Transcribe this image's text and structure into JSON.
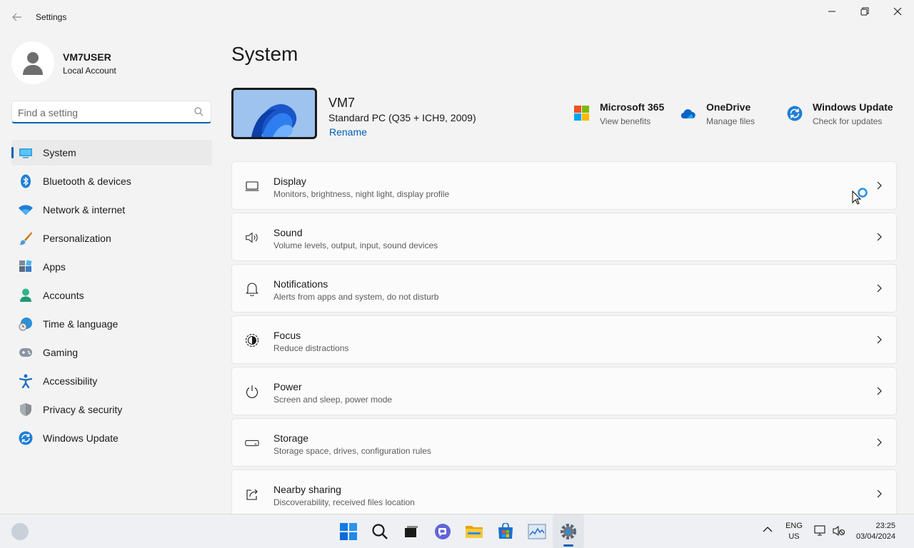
{
  "window": {
    "title": "Settings"
  },
  "user": {
    "name": "VM7USER",
    "account_type": "Local Account"
  },
  "search": {
    "placeholder": "Find a setting"
  },
  "nav": {
    "items": [
      {
        "label": "System",
        "icon": "monitor-icon",
        "active": true
      },
      {
        "label": "Bluetooth & devices",
        "icon": "bluetooth-icon"
      },
      {
        "label": "Network & internet",
        "icon": "wifi-icon"
      },
      {
        "label": "Personalization",
        "icon": "brush-icon"
      },
      {
        "label": "Apps",
        "icon": "apps-icon"
      },
      {
        "label": "Accounts",
        "icon": "person-icon"
      },
      {
        "label": "Time & language",
        "icon": "globe-clock-icon"
      },
      {
        "label": "Gaming",
        "icon": "gamepad-icon"
      },
      {
        "label": "Accessibility",
        "icon": "accessibility-icon"
      },
      {
        "label": "Privacy & security",
        "icon": "shield-icon"
      },
      {
        "label": "Windows Update",
        "icon": "update-icon"
      }
    ]
  },
  "page": {
    "title": "System"
  },
  "device": {
    "name": "VM7",
    "spec": "Standard PC (Q35 + ICH9, 2009)",
    "rename_label": "Rename"
  },
  "quick_links": [
    {
      "title": "Microsoft 365",
      "subtitle": "View benefits",
      "icon": "microsoft-logo-icon"
    },
    {
      "title": "OneDrive",
      "subtitle": "Manage files",
      "icon": "cloud-icon"
    },
    {
      "title": "Windows Update",
      "subtitle": "Check for updates",
      "icon": "update-icon"
    }
  ],
  "settings_cards": [
    {
      "title": "Display",
      "subtitle": "Monitors, brightness, night light, display profile",
      "icon": "laptop-icon"
    },
    {
      "title": "Sound",
      "subtitle": "Volume levels, output, input, sound devices",
      "icon": "speaker-icon"
    },
    {
      "title": "Notifications",
      "subtitle": "Alerts from apps and system, do not disturb",
      "icon": "bell-icon"
    },
    {
      "title": "Focus",
      "subtitle": "Reduce distractions",
      "icon": "focus-icon"
    },
    {
      "title": "Power",
      "subtitle": "Screen and sleep, power mode",
      "icon": "power-icon"
    },
    {
      "title": "Storage",
      "subtitle": "Storage space, drives, configuration rules",
      "icon": "storage-icon"
    },
    {
      "title": "Nearby sharing",
      "subtitle": "Discoverability, received files location",
      "icon": "share-icon"
    }
  ],
  "taskbar": {
    "language": {
      "line1": "ENG",
      "line2": "US"
    },
    "clock": {
      "time": "23:25",
      "date": "03/04/2024"
    }
  },
  "colors": {
    "accent": "#005fb8",
    "background": "#f3f3f3",
    "card": "#fbfbfb"
  }
}
